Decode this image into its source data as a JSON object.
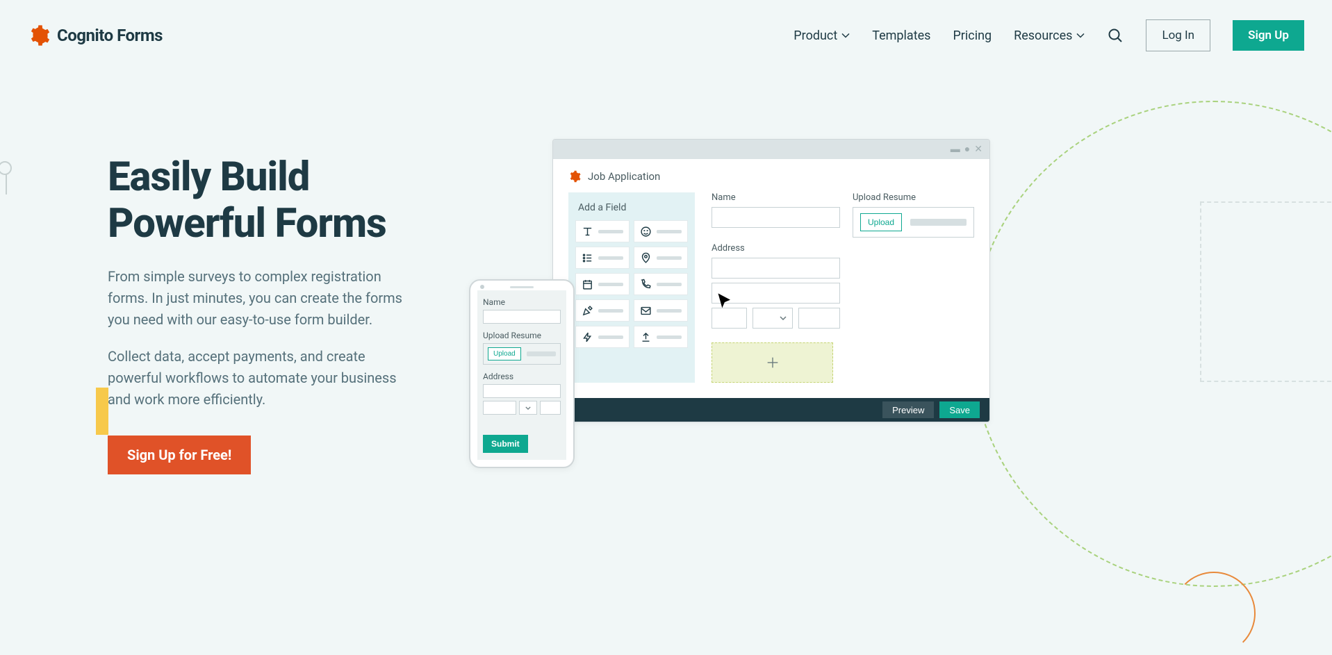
{
  "header": {
    "brand": "Cognito Forms",
    "nav": {
      "product": "Product",
      "templates": "Templates",
      "pricing": "Pricing",
      "resources": "Resources"
    },
    "login": "Log In",
    "signup": "Sign Up"
  },
  "hero": {
    "title_line1": "Easily Build",
    "title_line2": "Powerful Forms",
    "p1": "From simple surveys to complex registration forms. In just minutes, you can create the forms you need with our easy-to-use form builder.",
    "p2": "Collect data, accept payments, and create powerful workflows to automate your business and work more efficiently.",
    "cta": "Sign Up for Free!"
  },
  "builder": {
    "title": "Job Application",
    "add_field": "Add a Field",
    "labels": {
      "name": "Name",
      "upload_resume": "Upload Resume",
      "upload_btn": "Upload",
      "address": "Address"
    },
    "footer": {
      "preview": "Preview",
      "save": "Save"
    }
  },
  "phone": {
    "name": "Name",
    "upload_resume": "Upload Resume",
    "upload_btn": "Upload",
    "address": "Address",
    "submit": "Submit"
  }
}
